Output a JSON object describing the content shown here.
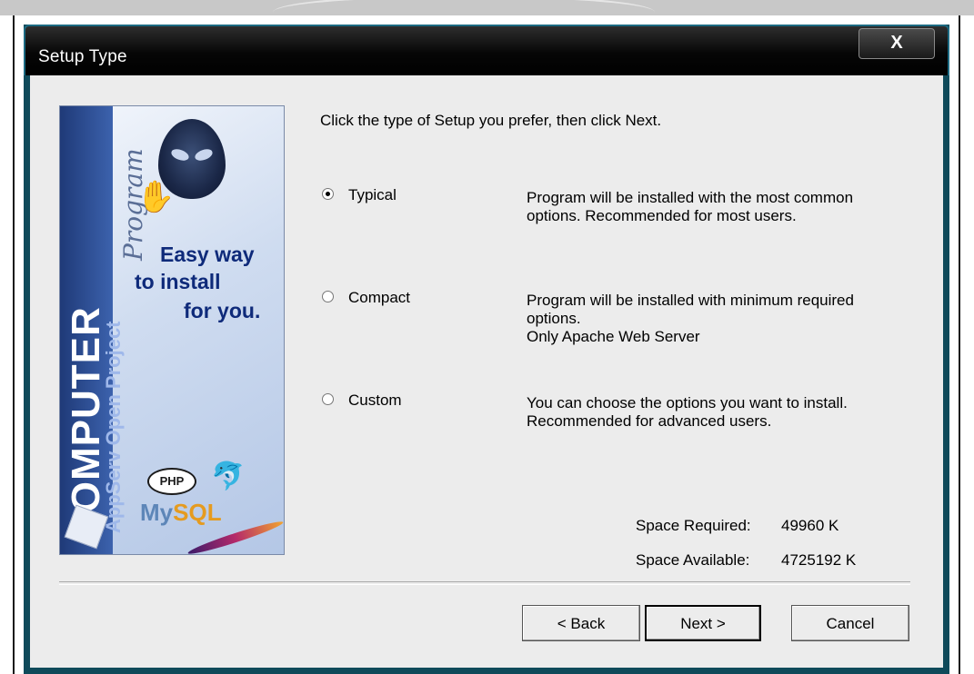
{
  "window": {
    "title": "Setup Type",
    "close_label": "X"
  },
  "banner": {
    "brand_vertical": "COMPUTER",
    "product_vertical": "AppServ Open Project",
    "script_vertical": "Program",
    "tagline_line1": "Easy way",
    "tagline_line2": "to install",
    "tagline_line3": "for you.",
    "php_label": "PHP",
    "mysql_label_a": "My",
    "mysql_label_b": "SQL"
  },
  "instruction": "Click the type of Setup you prefer, then click Next.",
  "options": [
    {
      "label": "Typical",
      "selected": true,
      "description": "Program will be installed with the most common options. Recommended for most users."
    },
    {
      "label": "Compact",
      "selected": false,
      "description_line1": "Program will be installed with minimum required options.",
      "description_line2": "Only Apache Web Server"
    },
    {
      "label": "Custom",
      "selected": false,
      "description": "You can choose the options you want to install. Recommended for advanced users."
    }
  ],
  "space": {
    "required_label": "Space Required:",
    "required_value": "49960 K",
    "available_label": "Space Available:",
    "available_value": "4725192 K"
  },
  "buttons": {
    "back": "< Back",
    "next": "Next >",
    "cancel": "Cancel"
  },
  "colors": {
    "titlebar": "#000000",
    "frame": "#0f4a5a",
    "client_bg": "#ececec",
    "banner_accent": "#1f3a78"
  }
}
